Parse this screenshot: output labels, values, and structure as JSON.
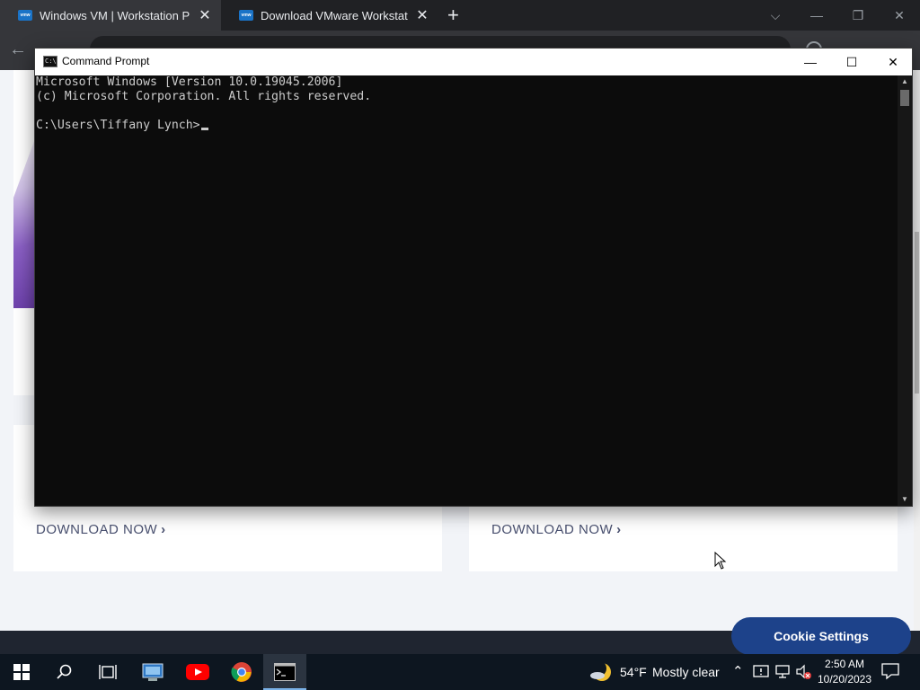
{
  "browser": {
    "tabs": [
      {
        "label": "Windows VM | Workstation Pro |",
        "favicon": "vmw"
      },
      {
        "label": "Download VMware Workstation",
        "favicon": "vmw"
      }
    ],
    "new_tab_symbol": "+"
  },
  "page": {
    "cards": [
      {
        "link_label": "DOWNLOAD NOW"
      },
      {
        "link_label": "DOWNLOAD NOW"
      }
    ],
    "cookie_button": "Cookie Settings"
  },
  "cmd": {
    "title": "Command Prompt",
    "icon_text": "C:\\",
    "lines": [
      "Microsoft Windows [Version 10.0.19045.2006]",
      "(c) Microsoft Corporation. All rights reserved.",
      "",
      "C:\\Users\\Tiffany Lynch>"
    ]
  },
  "taskbar": {
    "weather": {
      "temp": "54°F",
      "desc": "Mostly clear"
    },
    "clock": {
      "time": "2:50 AM",
      "date": "10/20/2023"
    }
  },
  "colors": {
    "cookie_button": "#1d428a",
    "cmd_background": "#0c0c0c",
    "taskbar": "#0d1620",
    "browser_tab_active": "#35363a"
  }
}
